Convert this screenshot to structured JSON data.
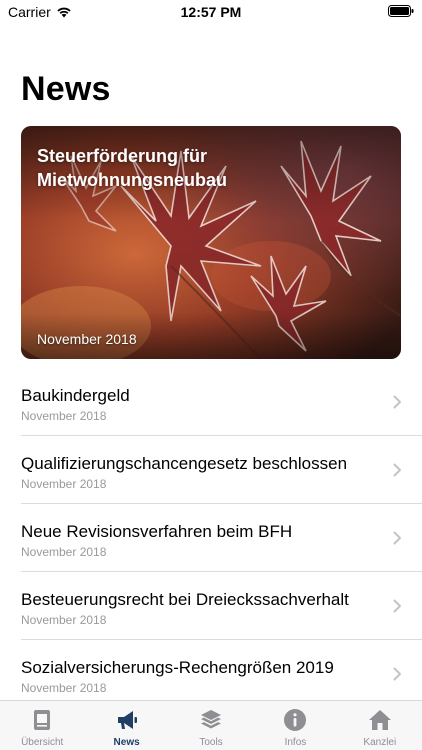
{
  "status_bar": {
    "carrier": "Carrier",
    "time": "12:57 PM"
  },
  "page": {
    "title": "News"
  },
  "hero": {
    "title": "Steuerförderung für Mietwohnungsneubau",
    "date": "November 2018"
  },
  "news": [
    {
      "title": "Baukindergeld",
      "date": "November 2018"
    },
    {
      "title": "Qualifizierungschancengesetz beschlossen",
      "date": "November 2018"
    },
    {
      "title": "Neue Revisionsverfahren beim BFH",
      "date": "November 2018"
    },
    {
      "title": "Besteuerungsrecht bei Dreieckssachverhalt",
      "date": "November 2018"
    },
    {
      "title": "Sozialversicherungs-Rechengrößen 2019",
      "date": "November 2018"
    }
  ],
  "tabs": [
    {
      "label": "Übersicht",
      "icon": "document-icon"
    },
    {
      "label": "News",
      "icon": "megaphone-icon"
    },
    {
      "label": "Tools",
      "icon": "layers-icon"
    },
    {
      "label": "Infos",
      "icon": "info-icon"
    },
    {
      "label": "Kanzlei",
      "icon": "house-icon"
    }
  ],
  "colors": {
    "active_tab": "#1f3f66",
    "inactive_tab": "#8e8e93",
    "secondary_text": "#9a9a9a"
  }
}
